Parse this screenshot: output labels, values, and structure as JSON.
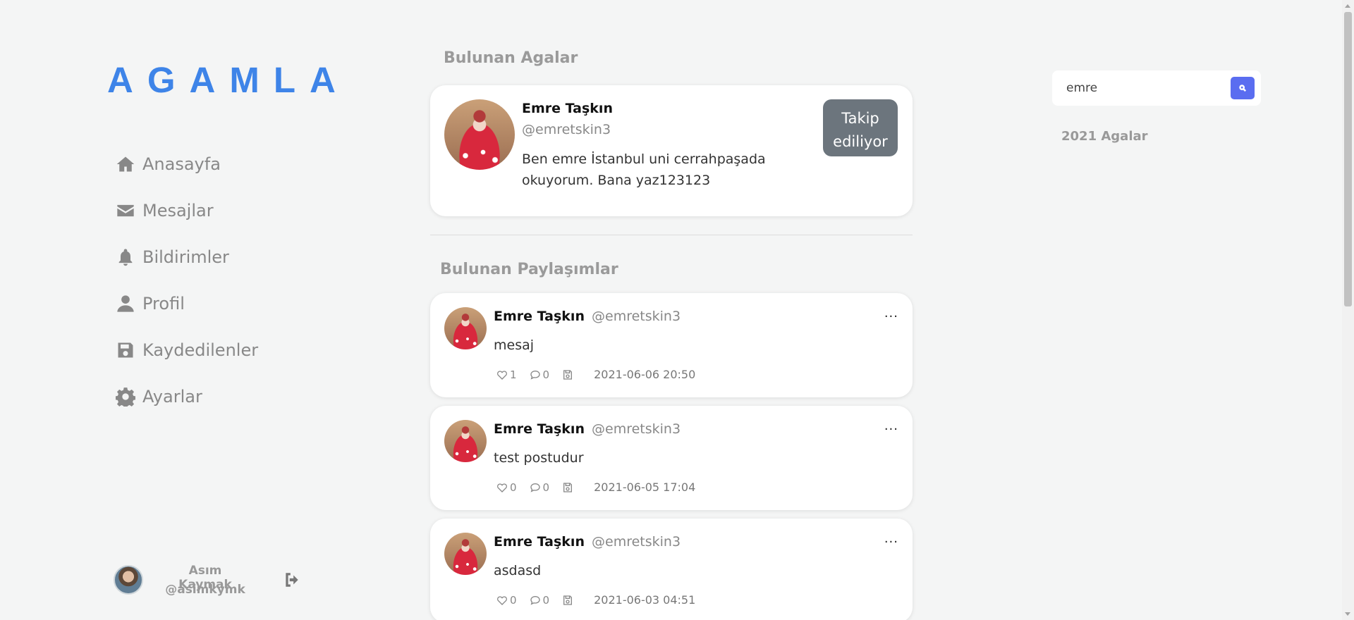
{
  "brand": {
    "logo": "AGAMLA",
    "color": "#3e84e8"
  },
  "nav": {
    "items": [
      {
        "label": "Anasayfa",
        "icon": "home-icon"
      },
      {
        "label": "Mesajlar",
        "icon": "envelope-icon"
      },
      {
        "label": "Bildirimler",
        "icon": "bell-icon"
      },
      {
        "label": "Profil",
        "icon": "user-icon"
      },
      {
        "label": "Kaydedilenler",
        "icon": "save-icon"
      },
      {
        "label": "Ayarlar",
        "icon": "gear-icon"
      }
    ]
  },
  "current_user": {
    "name": "Asım Kaymak",
    "handle": "@asimkymk"
  },
  "sections": {
    "people_title": "Bulunan Agalar",
    "posts_title": "Bulunan Paylaşımlar"
  },
  "found_user": {
    "name": "Emre Taşkın",
    "handle": "@emretskin3",
    "bio": "Ben emre İstanbul uni cerrahpaşada okuyorum. Bana yaz123123",
    "follow_label_line1": "Takip",
    "follow_label_line2": "ediliyor"
  },
  "posts": [
    {
      "name": "Emre Taşkın",
      "handle": "@emretskin3",
      "text": "mesaj",
      "likes": "1",
      "comments": "0",
      "date": "2021-06-06 20:50",
      "more": "..."
    },
    {
      "name": "Emre Taşkın",
      "handle": "@emretskin3",
      "text": "test postudur",
      "likes": "0",
      "comments": "0",
      "date": "2021-06-05 17:04",
      "more": "..."
    },
    {
      "name": "Emre Taşkın",
      "handle": "@emretskin3",
      "text": "asdasd",
      "likes": "0",
      "comments": "0",
      "date": "2021-06-03 04:51",
      "more": "..."
    }
  ],
  "search": {
    "value": "emre",
    "button_icon": "search-icon",
    "button_color": "#5a6df0"
  },
  "right": {
    "year_title": "2021 Agalar"
  }
}
